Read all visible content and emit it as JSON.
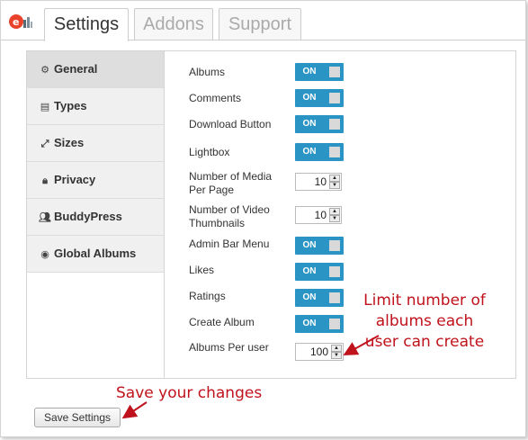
{
  "tabs": [
    {
      "label": "Settings",
      "active": true
    },
    {
      "label": "Addons",
      "active": false
    },
    {
      "label": "Support",
      "active": false
    }
  ],
  "sidebar": {
    "items": [
      {
        "label": "General",
        "icon": "gears-icon",
        "active": true
      },
      {
        "label": "Types",
        "icon": "film-icon",
        "active": false
      },
      {
        "label": "Sizes",
        "icon": "resize-icon",
        "active": false
      },
      {
        "label": "Privacy",
        "icon": "lock-icon",
        "active": false
      },
      {
        "label": "BuddyPress",
        "icon": "users-icon",
        "active": false
      },
      {
        "label": "Global Albums",
        "icon": "globe-icon",
        "active": false
      }
    ]
  },
  "settings": {
    "albums": {
      "label": "Albums",
      "value": "ON"
    },
    "comments": {
      "label": "Comments",
      "value": "ON"
    },
    "download_button": {
      "label": "Download Button",
      "value": "ON"
    },
    "lightbox": {
      "label": "Lightbox",
      "value": "ON"
    },
    "media_per_page": {
      "label": "Number of Media Per Page",
      "value": "10"
    },
    "video_thumbnails": {
      "label": "Number of Video Thumbnails",
      "value": "10"
    },
    "admin_bar_menu": {
      "label": "Admin Bar Menu",
      "value": "ON"
    },
    "likes": {
      "label": "Likes",
      "value": "ON"
    },
    "ratings": {
      "label": "Ratings",
      "value": "ON"
    },
    "create_album": {
      "label": "Create Album",
      "value": "ON"
    },
    "albums_per_user": {
      "label": "Albums Per user",
      "value": "100"
    }
  },
  "save_button": {
    "label": "Save Settings"
  },
  "annotations": {
    "limit": "Limit number of albums each user can create",
    "save": "Save your changes"
  },
  "colors": {
    "toggle_on": "#2a95c5",
    "annotation": "#c0121c"
  }
}
